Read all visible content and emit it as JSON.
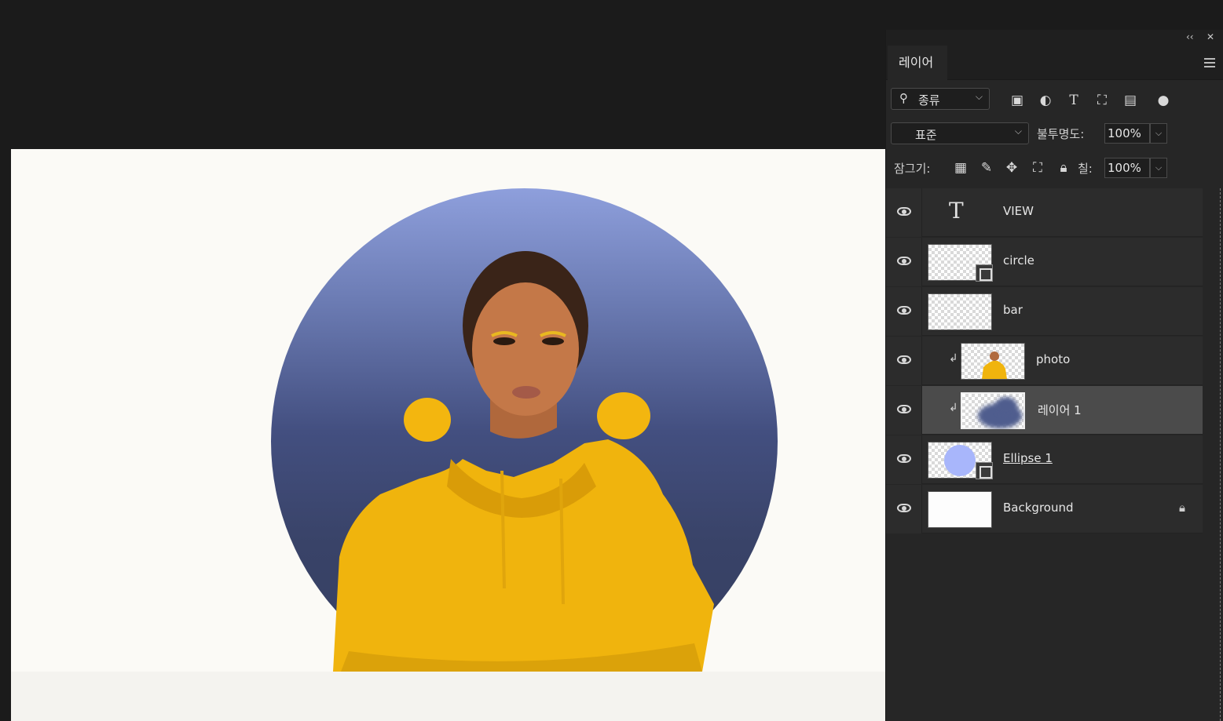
{
  "panel": {
    "collapse_icon": "‹‹",
    "close_icon": "✕",
    "tab_label": "레이어",
    "filter": {
      "label": "종류",
      "chevron": "⌵"
    },
    "filter_icons": [
      "image-filter-icon",
      "adjustment-filter-icon",
      "type-filter-icon",
      "shape-filter-icon",
      "smart-object-filter-icon",
      "filter-toggle-icon"
    ],
    "blend_mode": "표준",
    "opacity_label": "불투명도:",
    "opacity_value": "100%",
    "lock_label": "잠그기:",
    "fill_label": "칠:",
    "fill_value": "100%"
  },
  "layers": [
    {
      "name": "VIEW",
      "kind": "text",
      "visible": true,
      "selected": false,
      "clipped": false
    },
    {
      "name": "circle",
      "kind": "shape",
      "visible": true,
      "selected": false,
      "clipped": false
    },
    {
      "name": "bar",
      "kind": "pixel",
      "visible": true,
      "selected": false,
      "clipped": false
    },
    {
      "name": "photo",
      "kind": "pixel",
      "visible": true,
      "selected": false,
      "clipped": true
    },
    {
      "name": "레이어 1",
      "kind": "pixel",
      "visible": true,
      "selected": true,
      "clipped": true
    },
    {
      "name": "Ellipse 1",
      "kind": "shape",
      "visible": true,
      "selected": false,
      "clipped": false
    },
    {
      "name": "Background",
      "kind": "background",
      "visible": true,
      "selected": false,
      "clipped": false,
      "locked": true
    }
  ],
  "colors": {
    "circle_top": "#8e9fdc",
    "circle_bottom": "#353e61",
    "hoodie": "#f2b90e",
    "ellipse_thumb": "#a8b6fb",
    "canvas_bg": "#fbfaf6"
  }
}
